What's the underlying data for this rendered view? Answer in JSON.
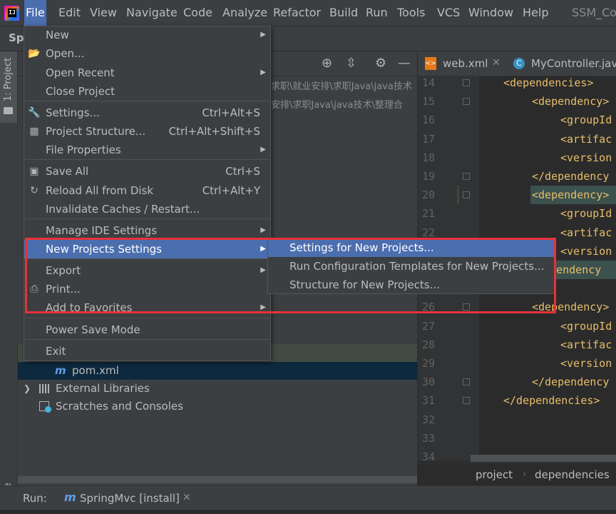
{
  "menubar": {
    "items": [
      "File",
      "Edit",
      "View",
      "Navigate",
      "Code",
      "Analyze",
      "Refactor",
      "Build",
      "Run",
      "Tools",
      "VCS",
      "Window",
      "Help"
    ],
    "window_title": "SSM_Co"
  },
  "navbar": {
    "project_name": "Spr"
  },
  "left_strip": {
    "project_tab": "1: Project",
    "structure_tab": "ucture"
  },
  "project_panel": {
    "paths": [
      "求职\\就业安排\\求职Java\\java技术",
      "安排\\求职Java\\java技术\\整理合"
    ],
    "tree": [
      {
        "label": "pom.xml",
        "icon": "maven-file-icon"
      },
      {
        "label": "External Libraries",
        "icon": "library-icon"
      },
      {
        "label": "Scratches and Consoles",
        "icon": "scratches-icon"
      }
    ]
  },
  "editor": {
    "tabs": [
      {
        "label": "web.xml",
        "icon": "xml-file-icon"
      },
      {
        "label": "MyController.jav",
        "icon": "class-icon"
      }
    ],
    "lines": [
      {
        "num": "14",
        "code": "<dependencies>"
      },
      {
        "num": "15",
        "code": "<dependency>"
      },
      {
        "num": "16",
        "code": "<groupId"
      },
      {
        "num": "17",
        "code": "<artifac"
      },
      {
        "num": "18",
        "code": "<version"
      },
      {
        "num": "19",
        "code": "</dependency"
      },
      {
        "num": "20",
        "code": "<dependency>"
      },
      {
        "num": "21",
        "code": "<groupId"
      },
      {
        "num": "22",
        "code": "<artifac"
      },
      {
        "num": "23",
        "code": "<version"
      },
      {
        "num": "24",
        "code": "ependency"
      },
      {
        "num": "25",
        "code": ""
      },
      {
        "num": "26",
        "code": "<dependency>"
      },
      {
        "num": "27",
        "code": "<groupId"
      },
      {
        "num": "28",
        "code": "<artifac"
      },
      {
        "num": "29",
        "code": "<version"
      },
      {
        "num": "30",
        "code": "</dependency"
      },
      {
        "num": "31",
        "code": "</dependencies>"
      },
      {
        "num": "32",
        "code": ""
      },
      {
        "num": "33",
        "code": ""
      },
      {
        "num": "34",
        "code": ""
      }
    ],
    "breadcrumb": [
      "project",
      "dependencies"
    ]
  },
  "file_menu": {
    "items": [
      {
        "label": "New",
        "shortcut": "",
        "submenu": true,
        "icon": ""
      },
      {
        "label": "Open...",
        "shortcut": "",
        "submenu": false,
        "icon": "folder-open-icon"
      },
      {
        "label": "Open Recent",
        "shortcut": "",
        "submenu": true,
        "icon": ""
      },
      {
        "label": "Close Project",
        "shortcut": "",
        "submenu": false,
        "icon": ""
      },
      {
        "label": "Settings...",
        "shortcut": "Ctrl+Alt+S",
        "submenu": false,
        "icon": "wrench-icon"
      },
      {
        "label": "Project Structure...",
        "shortcut": "Ctrl+Alt+Shift+S",
        "submenu": false,
        "icon": "project-structure-icon"
      },
      {
        "label": "File Properties",
        "shortcut": "",
        "submenu": true,
        "icon": ""
      },
      {
        "label": "Save All",
        "shortcut": "Ctrl+S",
        "submenu": false,
        "icon": "save-icon"
      },
      {
        "label": "Reload All from Disk",
        "shortcut": "Ctrl+Alt+Y",
        "submenu": false,
        "icon": "reload-icon"
      },
      {
        "label": "Invalidate Caches / Restart...",
        "shortcut": "",
        "submenu": false,
        "icon": ""
      },
      {
        "label": "Manage IDE Settings",
        "shortcut": "",
        "submenu": true,
        "icon": ""
      },
      {
        "label": "New Projects Settings",
        "shortcut": "",
        "submenu": true,
        "icon": ""
      },
      {
        "label": "Export",
        "shortcut": "",
        "submenu": true,
        "icon": ""
      },
      {
        "label": "Print...",
        "shortcut": "",
        "submenu": false,
        "icon": "print-icon"
      },
      {
        "label": "Add to Favorites",
        "shortcut": "",
        "submenu": true,
        "icon": ""
      },
      {
        "label": "Power Save Mode",
        "shortcut": "",
        "submenu": false,
        "icon": ""
      },
      {
        "label": "Exit",
        "shortcut": "",
        "submenu": false,
        "icon": ""
      }
    ]
  },
  "submenu": {
    "items": [
      "Settings for New Projects...",
      "Run Configuration Templates for New Projects...",
      "Structure for New Projects..."
    ]
  },
  "run_bar": {
    "label": "Run:",
    "config": "SpringMvc [install]"
  },
  "colors": {
    "highlight": "#4b6eaf",
    "annotation_box": "#e8313a",
    "tag": "#e8bf6a"
  }
}
